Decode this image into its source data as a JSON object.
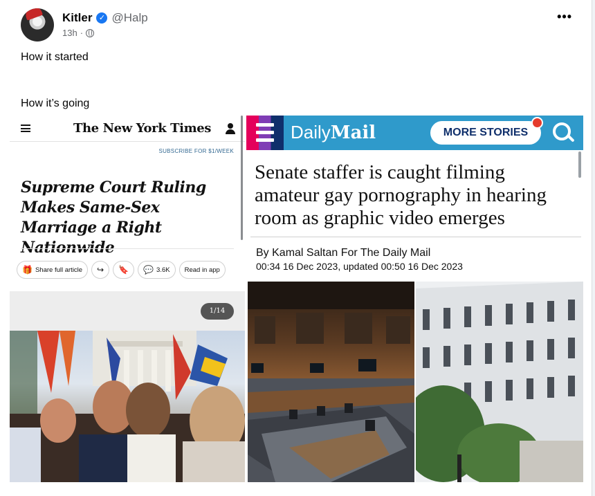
{
  "post": {
    "author": "Kitler",
    "handle": "@Halp",
    "time": "13h",
    "separator": "·",
    "more_label": "•••",
    "caption_top": "How it started",
    "caption_bottom": "How it’s going"
  },
  "nyt": {
    "logo": "The New York Times",
    "subscribe": "SUBSCRIBE FOR $1/WEEK",
    "headline": "Supreme Court Ruling Makes Same-Sex Marriage a Right Nationwide",
    "actions": {
      "share": "Share full article",
      "comments": "3.6K",
      "read": "Read in app"
    },
    "counter": "1/14"
  },
  "dailymail": {
    "logo_light": "Daily",
    "logo_bold": "Mail",
    "more_stories": "MORE STORIES",
    "headline": "Senate staffer is caught filming amateur gay pornography in hearing room as graphic video emerges",
    "byline": "By Kamal Saltan For The Daily Mail",
    "dateline": "00:34 16 Dec 2023, updated 00:50 16 Dec 2023"
  },
  "colors": {
    "verified": "#1877f2",
    "dm_bar": "#2f9acb",
    "dm_navy": "#0f2f6b",
    "nyt_link": "#326891"
  }
}
